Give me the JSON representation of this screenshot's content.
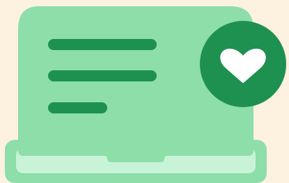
{
  "illustration": {
    "subject": "laptop-with-heart-badge",
    "icons": [
      "laptop-icon",
      "text-lines-icon",
      "heart-icon"
    ]
  },
  "colors": {
    "background": "#fdf1e0",
    "screen": "#8ddea9",
    "base": "#8ddea9",
    "base_inner": "#c8f3d6",
    "text_lines": "#1e9150",
    "badge": "#1e9150",
    "heart": "#ffffff"
  },
  "screen_text_lines": 3
}
